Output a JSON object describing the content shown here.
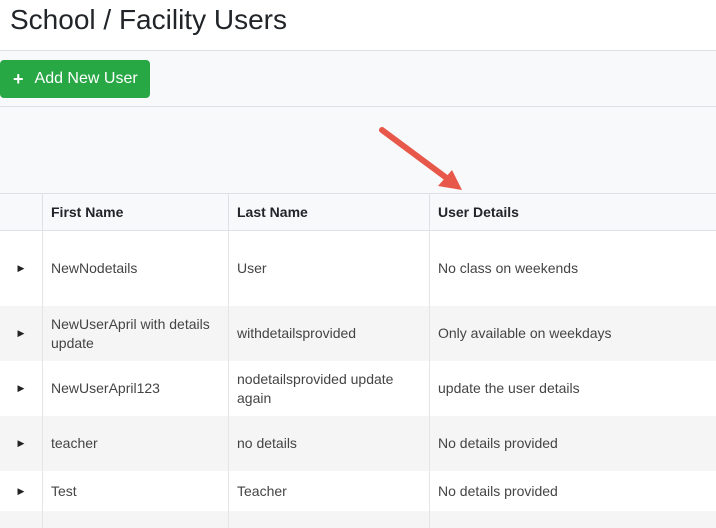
{
  "page": {
    "title": "School / Facility Users"
  },
  "toolbar": {
    "add_label": "Add New User",
    "add_icon": "plus-icon",
    "add_color": "#28a745"
  },
  "annotation": {
    "arrow_color": "#e8584a"
  },
  "table": {
    "columns": [
      "First Name",
      "Last Name",
      "User Details"
    ],
    "rows": [
      {
        "first": "NewNodetails",
        "last": "User",
        "details": "No class on weekends"
      },
      {
        "first": "NewUserApril with details update",
        "last": "withdetailsprovided",
        "details": "Only available on weekdays"
      },
      {
        "first": "NewUserApril123",
        "last": "nodetailsprovided update again",
        "details": "update the user details"
      },
      {
        "first": "teacher",
        "last": "no details",
        "details": "No details provided"
      },
      {
        "first": "Test",
        "last": "Teacher",
        "details": "No details provided"
      },
      {
        "first": "",
        "last": "",
        "details": ""
      }
    ]
  }
}
